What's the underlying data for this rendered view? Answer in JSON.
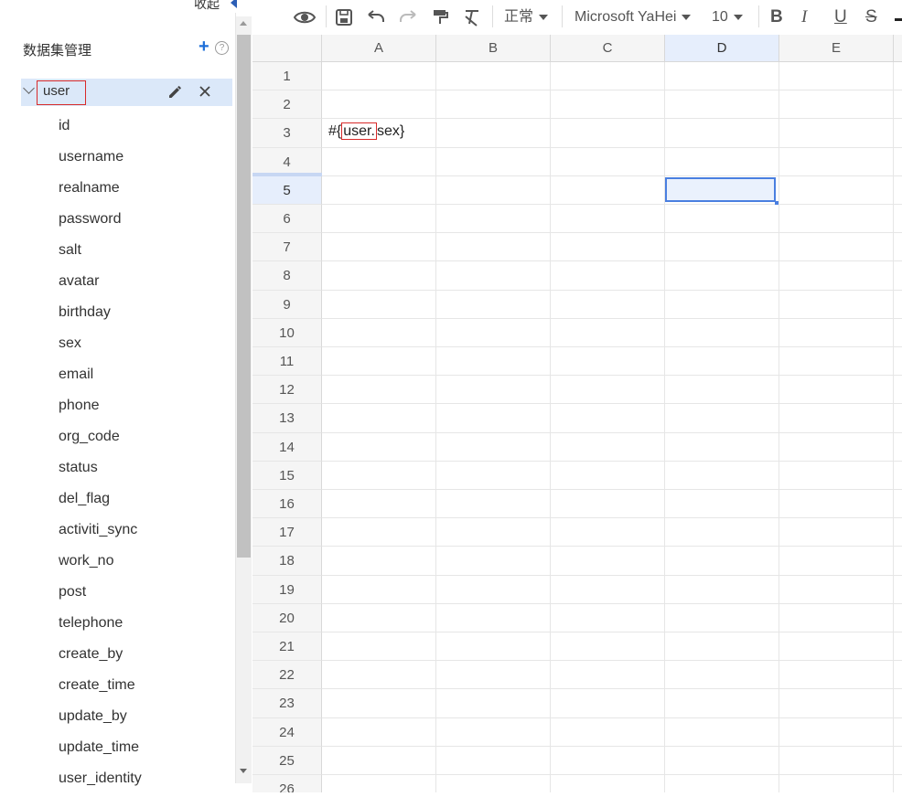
{
  "panel": {
    "collapse_label": "收起",
    "title": "数据集管理",
    "help": "?",
    "dataset": {
      "name": "user",
      "fields": [
        "id",
        "username",
        "realname",
        "password",
        "salt",
        "avatar",
        "birthday",
        "sex",
        "email",
        "phone",
        "org_code",
        "status",
        "del_flag",
        "activiti_sync",
        "work_no",
        "post",
        "telephone",
        "create_by",
        "create_time",
        "update_by",
        "update_time",
        "user_identity"
      ]
    }
  },
  "toolbar": {
    "style_value": "正常",
    "font_value": "Microsoft YaHei",
    "size_value": "10",
    "bold": "B",
    "italic": "I",
    "underline": "U",
    "strike": "S"
  },
  "sheet": {
    "columns": [
      "A",
      "B",
      "C",
      "D",
      "E"
    ],
    "rows": [
      "1",
      "2",
      "3",
      "4",
      "5",
      "6",
      "7",
      "8",
      "9",
      "10",
      "11",
      "12",
      "13",
      "14",
      "15",
      "16",
      "17",
      "18",
      "19",
      "20",
      "21",
      "22",
      "23",
      "24",
      "25",
      "26"
    ],
    "cell_a3": {
      "prefix": "#{",
      "boxed": "user.",
      "suffix": "sex}"
    },
    "selected_column": "D",
    "selected_row": "5"
  },
  "colors": {
    "accent": "#1e6fd9",
    "selection": "#4a7fe0",
    "highlight_row": "#dbe8f9",
    "error_box": "#d82a2a"
  }
}
